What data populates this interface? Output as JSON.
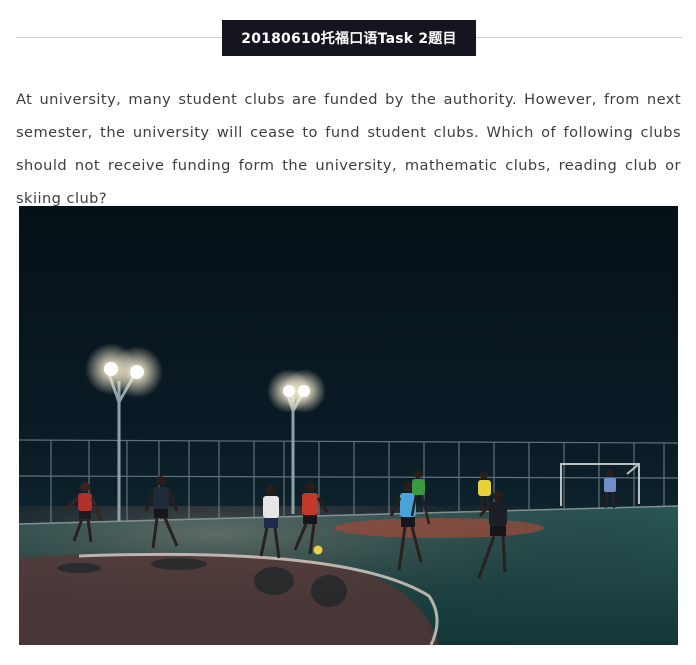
{
  "header": {
    "title": "20180610托福口语Task 2题目"
  },
  "question": {
    "text": "At university, many student clubs are funded by the authority. However, from next semester, the university will cease to fund student clubs. Which of following clubs should not receive funding form the university, mathematic clubs, reading club or skiing club?"
  },
  "photo": {
    "colors": {
      "sky": "#071219",
      "court": "#1f4a4a",
      "court_red": "#9a4a3a",
      "light": "#fff6e0"
    }
  }
}
